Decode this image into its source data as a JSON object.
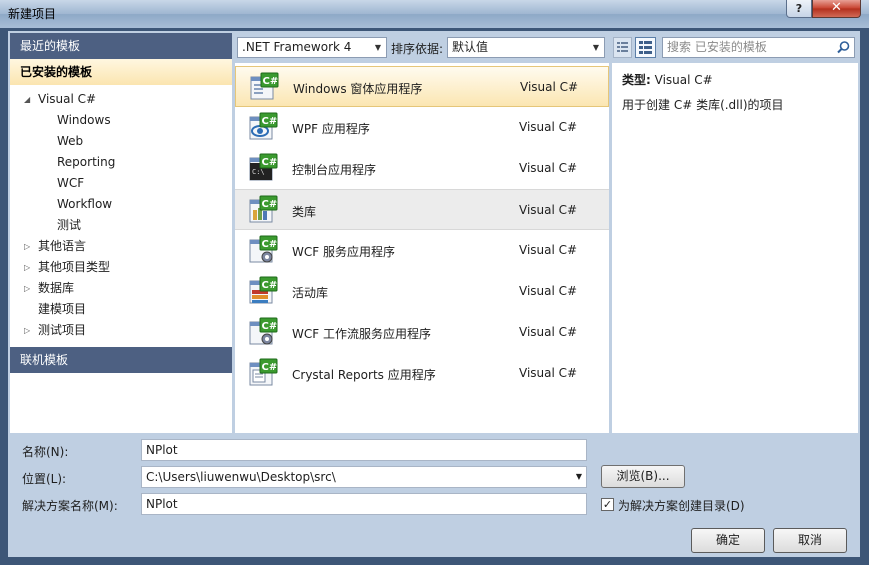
{
  "window": {
    "title": "新建项目",
    "help_label": "?",
    "close_label": "✕"
  },
  "left_panel": {
    "recent_header": "最近的模板",
    "installed_header": "已安装的模板",
    "online_header": "联机模板",
    "tree": [
      {
        "label": "Visual C#",
        "level": 0,
        "arrow": "◢",
        "expanded": true
      },
      {
        "label": "Windows",
        "level": 1,
        "arrow": ""
      },
      {
        "label": "Web",
        "level": 1,
        "arrow": ""
      },
      {
        "label": "Reporting",
        "level": 1,
        "arrow": ""
      },
      {
        "label": "WCF",
        "level": 1,
        "arrow": ""
      },
      {
        "label": "Workflow",
        "level": 1,
        "arrow": ""
      },
      {
        "label": "测试",
        "level": 1,
        "arrow": ""
      },
      {
        "label": "其他语言",
        "level": 0,
        "arrow": "▷"
      },
      {
        "label": "其他项目类型",
        "level": 0,
        "arrow": "▷"
      },
      {
        "label": "数据库",
        "level": 0,
        "arrow": "▷"
      },
      {
        "label": "建模项目",
        "level": 0,
        "arrow": ""
      },
      {
        "label": "测试项目",
        "level": 0,
        "arrow": "▷"
      }
    ]
  },
  "toolbar": {
    "framework": ".NET Framework 4",
    "sort_label": "排序依据:",
    "sort_value": "默认值",
    "search_placeholder": "搜索 已安装的模板"
  },
  "templates": [
    {
      "name": "Windows 窗体应用程序",
      "lang": "Visual C#",
      "icon": "windows-forms-icon",
      "state": "selected"
    },
    {
      "name": "WPF 应用程序",
      "lang": "Visual C#",
      "icon": "wpf-icon",
      "state": ""
    },
    {
      "name": "控制台应用程序",
      "lang": "Visual C#",
      "icon": "console-icon",
      "state": ""
    },
    {
      "name": "类库",
      "lang": "Visual C#",
      "icon": "class-library-icon",
      "state": "hover"
    },
    {
      "name": "WCF 服务应用程序",
      "lang": "Visual C#",
      "icon": "wcf-service-icon",
      "state": ""
    },
    {
      "name": "活动库",
      "lang": "Visual C#",
      "icon": "activity-library-icon",
      "state": ""
    },
    {
      "name": "WCF 工作流服务应用程序",
      "lang": "Visual C#",
      "icon": "wcf-workflow-icon",
      "state": ""
    },
    {
      "name": "Crystal Reports 应用程序",
      "lang": "Visual C#",
      "icon": "crystal-reports-icon",
      "state": ""
    }
  ],
  "description": {
    "type_label": "类型:",
    "type_value": "Visual C#",
    "text": "用于创建 C# 类库(.dll)的项目"
  },
  "form": {
    "name_label": "名称(N):",
    "name_value": "NPlot",
    "location_label": "位置(L):",
    "location_value": "C:\\Users\\liuwenwu\\Desktop\\src\\",
    "solution_label": "解决方案名称(M):",
    "solution_value": "NPlot",
    "browse_label": "浏览(B)...",
    "create_dir_label": "为解决方案创建目录(D)",
    "create_dir_checked": true
  },
  "buttons": {
    "ok": "确定",
    "cancel": "取消"
  },
  "colors": {
    "header_blue": "#4d6082",
    "selection": "#fbe6b2",
    "accent_green": "#3b9a2f"
  }
}
